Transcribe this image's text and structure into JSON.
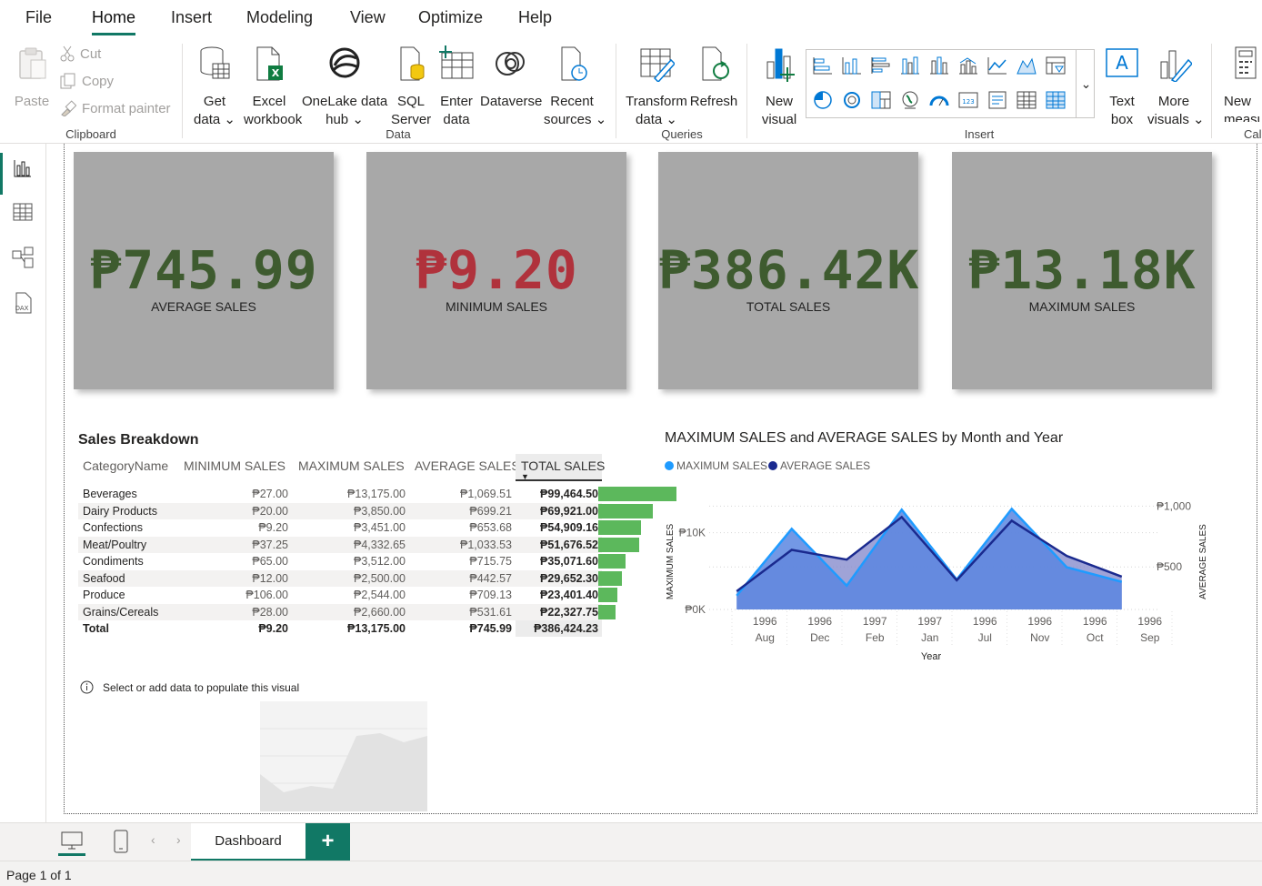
{
  "menu": {
    "file": "File",
    "home": "Home",
    "insert": "Insert",
    "modeling": "Modeling",
    "view": "View",
    "optimize": "Optimize",
    "help": "Help"
  },
  "ribbon": {
    "clipboard": {
      "paste": "Paste",
      "cut": "Cut",
      "copy": "Copy",
      "format_painter": "Format painter",
      "group": "Clipboard"
    },
    "data": {
      "get_data_1": "Get",
      "get_data_2": "data",
      "excel_1": "Excel",
      "excel_2": "workbook",
      "onelake_1": "OneLake data",
      "onelake_2": "hub",
      "sql_1": "SQL",
      "sql_2": "Server",
      "enter_1": "Enter",
      "enter_2": "data",
      "dataverse": "Dataverse",
      "recent_1": "Recent",
      "recent_2": "sources",
      "group": "Data"
    },
    "queries": {
      "transform_1": "Transform",
      "transform_2": "data",
      "refresh": "Refresh",
      "group": "Queries"
    },
    "insert": {
      "new_visual_1": "New",
      "new_visual_2": "visual",
      "text_box_1": "Text",
      "text_box_2": "box",
      "more_visuals_1": "More",
      "more_visuals_2": "visuals",
      "group": "Insert"
    },
    "calc": {
      "new_measure_1": "New",
      "new_measure_2": "measu",
      "group": "Cal"
    }
  },
  "kpis": [
    {
      "value": "₱745.99",
      "label": "AVERAGE SALES",
      "color": "#3e5b2f"
    },
    {
      "value": "₱9.20",
      "label": "MINIMUM SALES",
      "color": "#b0323c"
    },
    {
      "value": "₱386.42K",
      "label": "TOTAL SALES",
      "color": "#3e5b2f"
    },
    {
      "value": "₱13.18K",
      "label": "MAXIMUM SALES",
      "color": "#3e5b2f"
    }
  ],
  "table": {
    "title": "Sales Breakdown",
    "headers": [
      "CategoryName",
      "MINIMUM SALES",
      "MAXIMUM SALES",
      "AVERAGE SALES",
      "TOTAL SALES"
    ],
    "rows": [
      {
        "name": "Beverages",
        "min": "₱27.00",
        "max": "₱13,175.00",
        "avg": "₱1,069.51",
        "total": "₱99,464.50",
        "pct": 1.0
      },
      {
        "name": "Dairy Products",
        "min": "₱20.00",
        "max": "₱3,850.00",
        "avg": "₱699.21",
        "total": "₱69,921.00",
        "pct": 0.7
      },
      {
        "name": "Confections",
        "min": "₱9.20",
        "max": "₱3,451.00",
        "avg": "₱653.68",
        "total": "₱54,909.16",
        "pct": 0.55
      },
      {
        "name": "Meat/Poultry",
        "min": "₱37.25",
        "max": "₱4,332.65",
        "avg": "₱1,033.53",
        "total": "₱51,676.52",
        "pct": 0.52
      },
      {
        "name": "Condiments",
        "min": "₱65.00",
        "max": "₱3,512.00",
        "avg": "₱715.75",
        "total": "₱35,071.60",
        "pct": 0.35
      },
      {
        "name": "Seafood",
        "min": "₱12.00",
        "max": "₱2,500.00",
        "avg": "₱442.57",
        "total": "₱29,652.30",
        "pct": 0.3
      },
      {
        "name": "Produce",
        "min": "₱106.00",
        "max": "₱2,544.00",
        "avg": "₱709.13",
        "total": "₱23,401.40",
        "pct": 0.24
      },
      {
        "name": "Grains/Cereals",
        "min": "₱28.00",
        "max": "₱2,660.00",
        "avg": "₱531.61",
        "total": "₱22,327.75",
        "pct": 0.22
      }
    ],
    "total": {
      "name": "Total",
      "min": "₱9.20",
      "max": "₱13,175.00",
      "avg": "₱745.99",
      "total": "₱386,424.23"
    }
  },
  "chart_data": {
    "type": "area",
    "title": "MAXIMUM SALES and AVERAGE SALES by Month and Year",
    "xlabel": "Year",
    "ylabel": "MAXIMUM SALES",
    "y2label": "AVERAGE SALES",
    "categories": [
      {
        "year": "1996",
        "month": "Aug"
      },
      {
        "year": "1996",
        "month": "Dec"
      },
      {
        "year": "1997",
        "month": "Feb"
      },
      {
        "year": "1997",
        "month": "Jan"
      },
      {
        "year": "1996",
        "month": "Jul"
      },
      {
        "year": "1996",
        "month": "Nov"
      },
      {
        "year": "1996",
        "month": "Oct"
      },
      {
        "year": "1996",
        "month": "Sep"
      }
    ],
    "series": [
      {
        "name": "MAXIMUM SALES",
        "axis": "left",
        "color": "#1f9bff",
        "values": [
          1800,
          10500,
          3100,
          13000,
          3900,
          13100,
          5500,
          3600
        ]
      },
      {
        "name": "AVERAGE SALES",
        "axis": "right",
        "color": "#1a2a8f",
        "values": [
          300,
          640,
          560,
          910,
          390,
          880,
          590,
          420
        ]
      }
    ],
    "y_ticks": [
      "₱0K",
      "₱10K"
    ],
    "y2_ticks": [
      "₱500",
      "₱1,000"
    ],
    "ylim": [
      0,
      16000
    ],
    "y2lim": [
      150,
      1160
    ]
  },
  "empty_visual": {
    "message": "Select or add data to populate this visual"
  },
  "pages": {
    "tab": "Dashboard",
    "add": "+"
  },
  "status": {
    "page": "Page 1 of 1"
  }
}
